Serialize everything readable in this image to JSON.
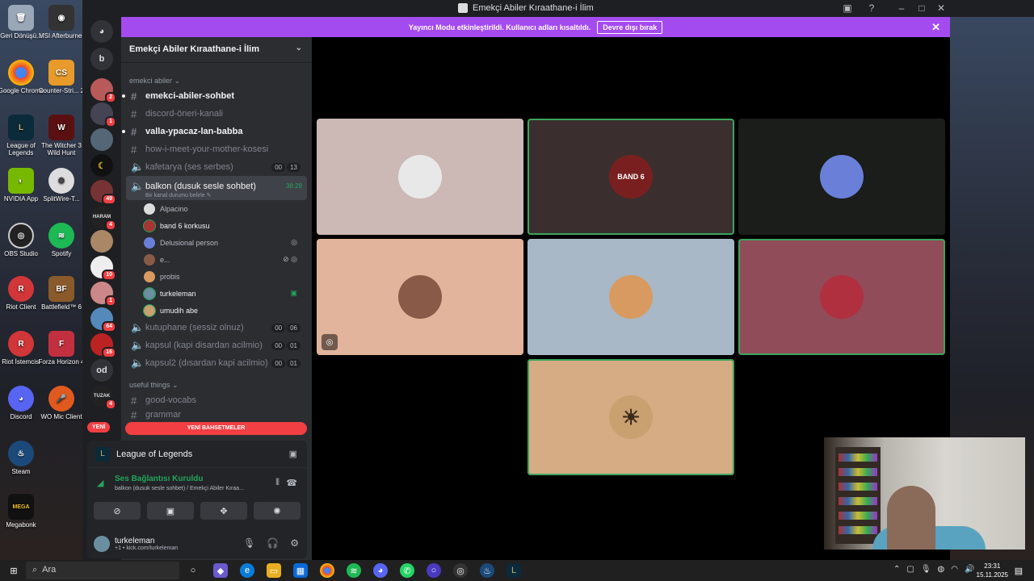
{
  "window": {
    "title": "Emekçi Abiler Kıraathane-i İlim"
  },
  "desktop_icons": [
    {
      "label": "Geri Dönüşü..."
    },
    {
      "label": "MSI Afterburner"
    },
    {
      "label": "Google Chrome"
    },
    {
      "label": "Counter-Stri... 2"
    },
    {
      "label": "League of Legends"
    },
    {
      "label": "The Witcher 3 Wild Hunt"
    },
    {
      "label": "NVIDIA App"
    },
    {
      "label": "SplitWire-T..."
    },
    {
      "label": "OBS Studio"
    },
    {
      "label": "Spotify"
    },
    {
      "label": "Riot Client"
    },
    {
      "label": "Battlefield™ 6"
    },
    {
      "label": "Riot İstemcisi"
    },
    {
      "label": "Forza Horizon 4"
    },
    {
      "label": "Discord"
    },
    {
      "label": "WO Mic Client"
    },
    {
      "label": "Steam"
    },
    {
      "label": "Megabonk"
    }
  ],
  "banner": {
    "text": "Yayıncı Modu etkinleştirildi. Kullanıcı adları kısaltıldı.",
    "button": "Devre dışı bırak",
    "accent": "#a44bf0"
  },
  "servers": {
    "letters": [
      "b",
      "od"
    ],
    "badges": [
      "2",
      "1",
      "49",
      "4",
      "1",
      "64",
      "16",
      "4",
      "10"
    ],
    "haram": "HARAM",
    "tuzak": "TUZAK"
  },
  "guild": {
    "name": "Emekçi Abiler Kıraathane-i İlim"
  },
  "category1": "emekci abiler",
  "category2": "useful things",
  "channels": [
    {
      "name": "emekci-abiler-sohbet",
      "type": "text",
      "unread": true
    },
    {
      "name": "discord-öneri-kanali",
      "type": "text",
      "unread": false
    },
    {
      "name": "valla-ypacaz-lan-babba",
      "type": "text",
      "unread": true
    },
    {
      "name": "how-i-meet-your-mother-kosesi",
      "type": "text",
      "unread": false
    },
    {
      "name": "kafetarya (ses serbes)",
      "type": "voice",
      "c1": "00",
      "c2": "13"
    },
    {
      "name": "balkon (dusuk sesle sohbet)",
      "type": "voice",
      "time": "38:28",
      "status": "Bir kanal durumu belirle"
    },
    {
      "name": "kutuphane (sessiz olnuz)",
      "type": "voice",
      "c1": "00",
      "c2": "06"
    },
    {
      "name": "kapsul (kapi disardan acilmio)",
      "type": "voice",
      "c1": "00",
      "c2": "01"
    },
    {
      "name": "kapsul2 (dısardan kapi acilmio)",
      "type": "voice",
      "c1": "00",
      "c2": "01"
    },
    {
      "name": "good-vocabs",
      "type": "text"
    },
    {
      "name": "grammar",
      "type": "text"
    }
  ],
  "voice_users": [
    "Alpacino",
    "band 6 korkusu",
    "Delusional person",
    "e...",
    "probis",
    "turkeleman",
    "umudih abe"
  ],
  "new_bar": {
    "new": "YENİ",
    "mentions": "YENİ BAHSETMELER"
  },
  "activity": {
    "game": "League of Legends"
  },
  "voice_status": {
    "title": "Ses Bağlantısı Kuruldu",
    "sub": "balkon (dusuk sesle sohbet) / Emekçi Abiler Kıraa..."
  },
  "user": {
    "name": "turkeleman",
    "status": "+1 • kick.com/turkeleman"
  },
  "tiles": [
    {
      "bg": "#ccb8b5",
      "label": "cat",
      "avbg": "#e8e8e8"
    },
    {
      "bg": "#3a2f2e",
      "label": "BAND 6",
      "avbg": "#7a1f1f"
    },
    {
      "bg": "#1a1d1a",
      "label": "",
      "avbg": "#6a7fd8"
    },
    {
      "bg": "#e2b49b",
      "label": "",
      "avbg": "#8a5a48"
    },
    {
      "bg": "#a8b8c6",
      "label": "",
      "avbg": "#d89a60"
    },
    {
      "bg": "#904c58",
      "label": "",
      "avbg": "#b03040"
    },
    {
      "bg": "#d6ac84",
      "label": "☀",
      "avbg": "#c9a070"
    }
  ],
  "taskbar": {
    "search": "Ara",
    "time": "23:31",
    "date": "15.11.2025"
  }
}
